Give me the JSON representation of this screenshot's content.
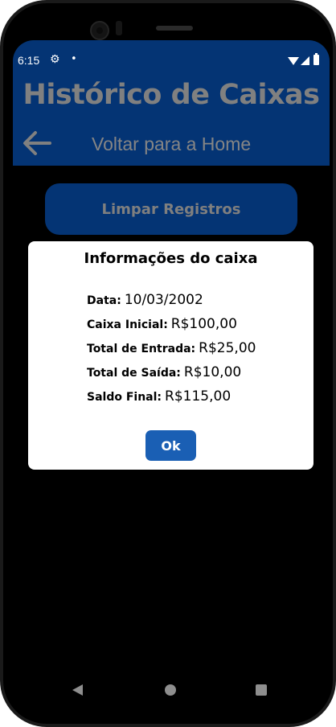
{
  "status_bar": {
    "time": "6:15",
    "settings_icon": "gear-icon",
    "notification_icon": "dot-icon"
  },
  "header": {
    "title": "Histórico de Caixas",
    "back_label": "Voltar para a Home",
    "back_icon": "arrow-left-icon"
  },
  "actions": {
    "clear_label": "Limpar Registros"
  },
  "modal": {
    "title": "Informações do caixa",
    "rows": [
      {
        "label": "Data:",
        "value": "10/03/2002"
      },
      {
        "label": "Caixa Inicial:",
        "value": "R$100,00"
      },
      {
        "label": "Total de Entrada:",
        "value": "R$25,00"
      },
      {
        "label": "Total de Saída:",
        "value": "R$10,00"
      },
      {
        "label": "Saldo Final:",
        "value": "R$115,00"
      }
    ],
    "ok_label": "Ok"
  },
  "colors": {
    "header_bg": "#043474",
    "button_bg": "#043474",
    "ok_bg": "#1a5fb4",
    "muted_text": "#808080"
  }
}
